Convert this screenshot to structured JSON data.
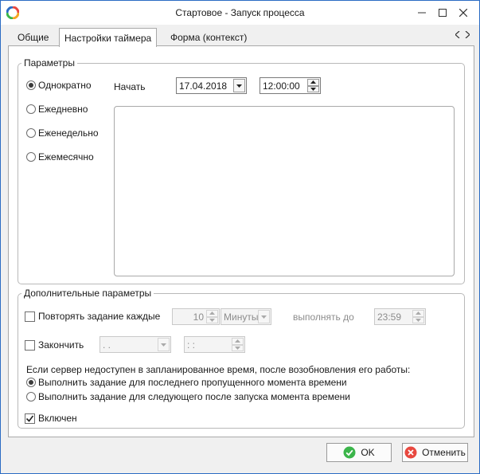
{
  "window": {
    "title": "Стартовое - Запуск процесса"
  },
  "tabs": [
    {
      "label": "Общие"
    },
    {
      "label": "Настройки таймера"
    },
    {
      "label": "Форма (контекст)"
    }
  ],
  "params": {
    "legend": "Параметры",
    "radios": [
      {
        "label": "Однократно",
        "checked": true
      },
      {
        "label": "Ежедневно",
        "checked": false
      },
      {
        "label": "Еженедельно",
        "checked": false
      },
      {
        "label": "Ежемесячно",
        "checked": false
      }
    ],
    "start_label": "Начать",
    "start_date": "17.04.2018",
    "start_time": "12:00:00"
  },
  "extra": {
    "legend": "Дополнительные параметры",
    "repeat_label": "Повторять задание каждые",
    "repeat_value": "10",
    "repeat_unit": "Минуты",
    "until_label": "выполнять до",
    "until_value": "23:59",
    "finish_label": "Закончить",
    "finish_date": " .  .",
    "finish_time": " :  :",
    "server_text": "Если сервер недоступен в запланированное время, после возобновления его работы:",
    "options": [
      {
        "label": "Выполнить задание для последнего пропущенного момента времени",
        "checked": true
      },
      {
        "label": "Выполнить задание для следующего после запуска момента времени",
        "checked": false
      }
    ],
    "enabled_label": "Включен"
  },
  "footer": {
    "ok_label": "OK",
    "cancel_label": "Отменить"
  },
  "colors": {
    "ok_icon": "#3bb54a",
    "cancel_icon": "#e8483f",
    "border_accent": "#2b6cc4"
  }
}
